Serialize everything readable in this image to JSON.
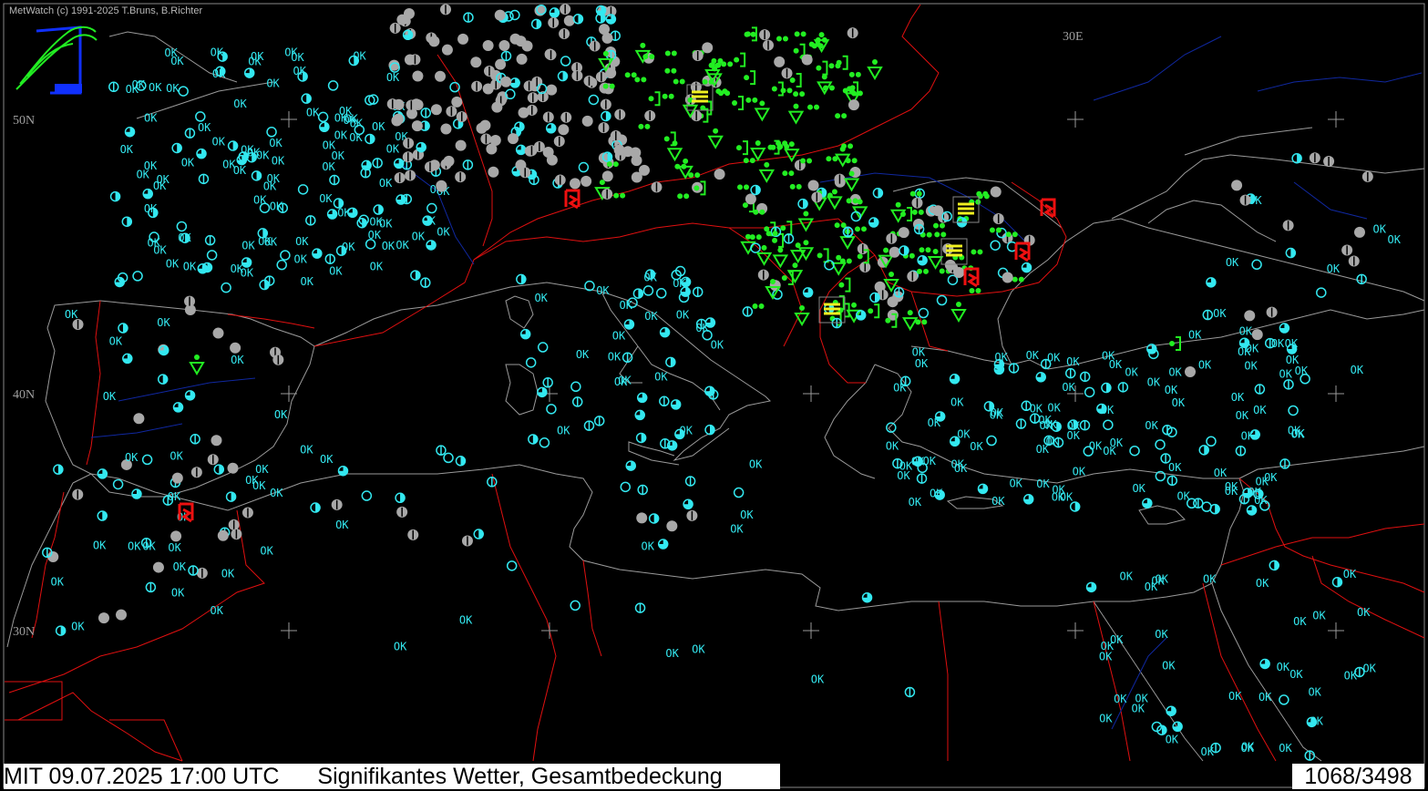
{
  "header": {
    "copyright": "MetWatch  (c) 1991-2025 T.Bruns, B.Richter"
  },
  "footer": {
    "datetime": "MIT 09.07.2025 17:00 UTC",
    "product": "Signifikantes Wetter, Gesamtbedeckung",
    "station_count": "1068/3498"
  },
  "grid_labels": {
    "lat_50": "50N",
    "lat_40": "40N",
    "lat_30": "30N",
    "lon_30": "30E"
  },
  "ok_label": "OK",
  "colors": {
    "background": "#000000",
    "coastline": "#9a9a9a",
    "border": "#e01010",
    "river": "#1028a0",
    "cloud_cover": "#33e8f0",
    "overcast": "#a8a8a8",
    "rain": "#22ee22",
    "fog": "#f0f020",
    "thunderstorm": "#ee1010"
  },
  "icons": [
    "metwatch-logo-icon",
    "cloud-cover-circle-icon",
    "rain-dot-icon",
    "shower-triangle-icon",
    "thunderstorm-icon",
    "fog-lines-icon",
    "overcast-disc-icon"
  ]
}
